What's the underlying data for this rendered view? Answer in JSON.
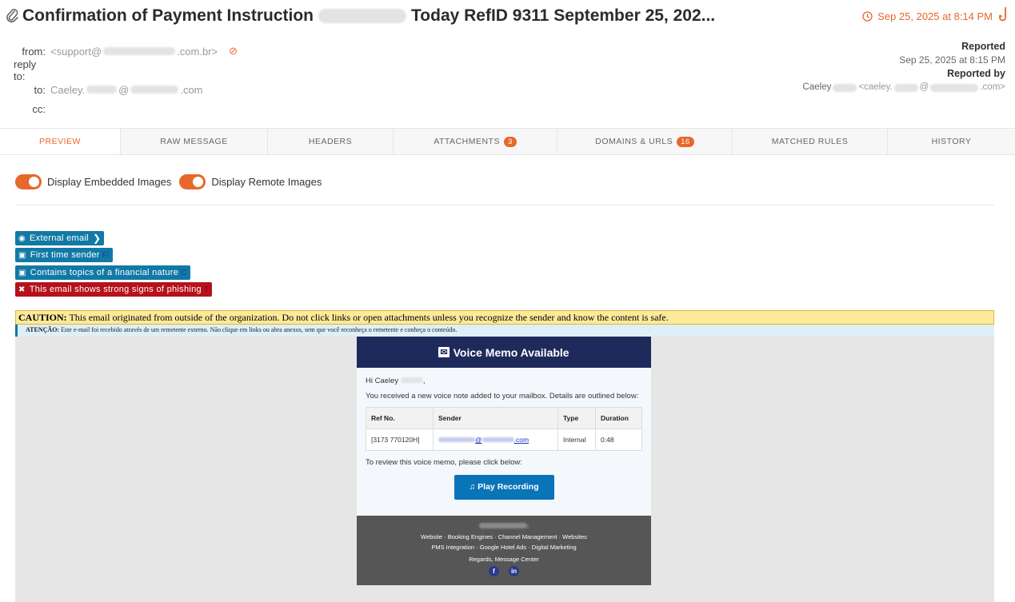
{
  "subject": {
    "prefix": "Confirmation of Payment Instruction",
    "suffix": "Today RefID 9311 September 25, 202..."
  },
  "received_date": "Sep 25, 2025 at 8:14 PM",
  "meta": {
    "from_label": "from:",
    "from_prefix": "<support@",
    "from_suffix": ".com.br>",
    "reply_to_label": "reply to:",
    "to_label": "to:",
    "to_prefix": "Caeley.",
    "to_mid": "@",
    "to_suffix": ".com",
    "cc_label": "cc:"
  },
  "reported": {
    "label": "Reported",
    "date": "Sep 25, 2025 at 8:15 PM",
    "by_label": "Reported by",
    "by_name": "Caeley",
    "by_prefix": "<caeley.",
    "by_mid": "@",
    "by_suffix": ".com>"
  },
  "tabs": [
    {
      "label": "PREVIEW",
      "active": true
    },
    {
      "label": "RAW MESSAGE"
    },
    {
      "label": "HEADERS"
    },
    {
      "label": "ATTACHMENTS",
      "badge": "3"
    },
    {
      "label": "DOMAINS & URLS",
      "badge": "16"
    },
    {
      "label": "MATCHED RULES"
    },
    {
      "label": "HISTORY"
    }
  ],
  "toggles": {
    "embedded": "Display Embedded Images",
    "remote": "Display Remote Images"
  },
  "banners": [
    {
      "label": "External email",
      "tail": ""
    },
    {
      "label": "First time sender",
      "tail": "Fi"
    },
    {
      "label": "Contains topics of a financial nature",
      "tail": "C"
    },
    {
      "label": "This email shows strong signs of phishing",
      "tail": "T"
    }
  ],
  "caution": {
    "bold": "CAUTION:",
    "text": "This email originated from outside of the organization. Do not click links or open attachments unless you recognize the sender and know the content is safe."
  },
  "atencao": {
    "bold": "ATENÇÃO:",
    "text": "Este e-mail foi recebido através de um remetente externo. Não clique em links ou abra anexos, sem que você reconheça o remetente e conheça o conteúdo."
  },
  "memo": {
    "title": "Voice Memo Available",
    "greeting": "Hi Caeley",
    "intro": "You received a new voice note added to your mailbox. Details are outlined below:",
    "headers": [
      "Ref No.",
      "Sender",
      "Type",
      "Duration"
    ],
    "row": {
      "ref": "[3173 770120H]",
      "sender_mid": "@",
      "sender_suffix": ".com",
      "type": "Internal",
      "duration": "0:48"
    },
    "review": "To review this voice memo, please click below:",
    "button": "Play Recording",
    "footer_links_1": "Website · Booking Engines · Channel Management · Websites",
    "footer_links_2": "PMS Integration · Google Hotel Ads · Digital Marketing",
    "regards": "Regards, Message Center"
  },
  "colors": {
    "accent": "#e8672a",
    "tag_blue": "#1279a6",
    "tag_red": "#b5121b",
    "memo_header": "#1f2a5c",
    "memo_button": "#0a74b8"
  }
}
